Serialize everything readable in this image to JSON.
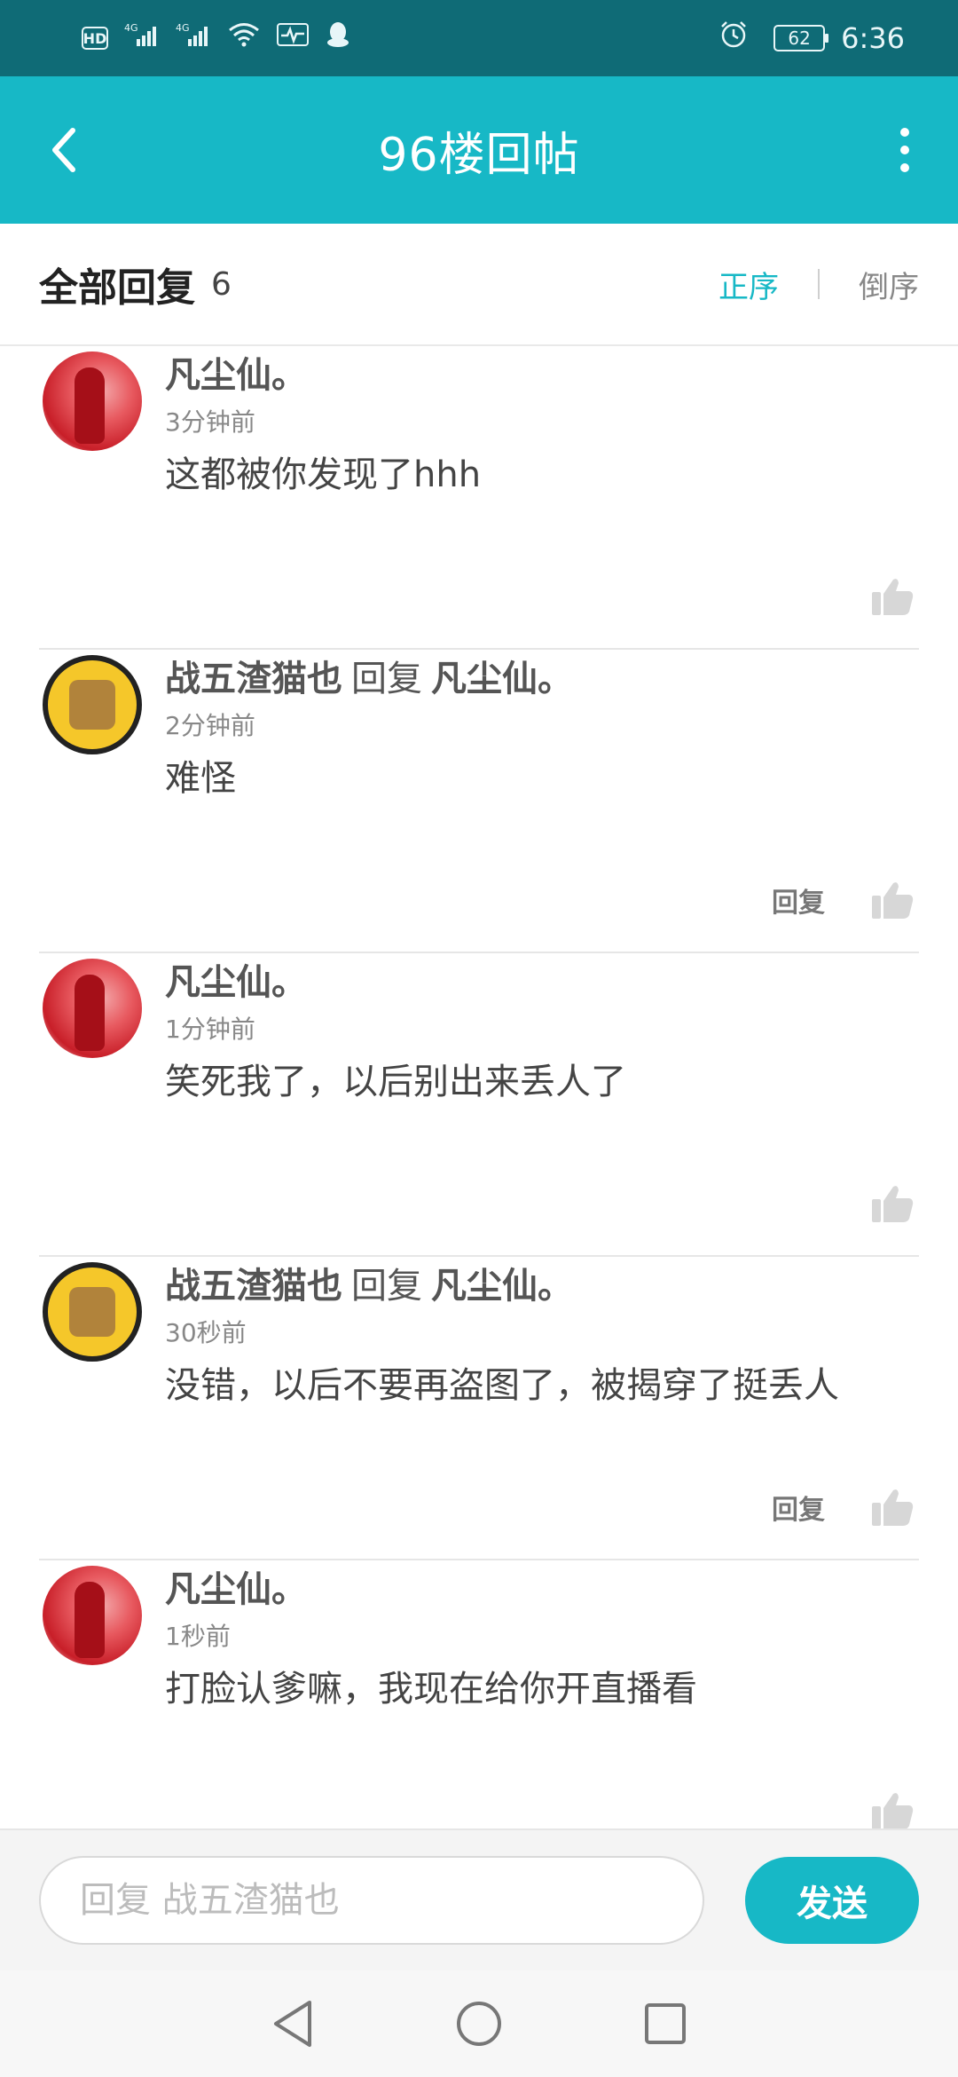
{
  "status_bar": {
    "left_icons": [
      "hd-icon",
      "signal-4g-icon",
      "signal-4g-icon",
      "wifi-icon",
      "pulse-icon",
      "qq-icon"
    ],
    "hd_label": "HD",
    "network_label": "4G",
    "alarm_icon": "alarm-icon",
    "battery_level": "62",
    "time": "6:36"
  },
  "header": {
    "title": "96楼回帖",
    "back_icon": "back-arrow-icon",
    "more_icon": "more-vertical-icon"
  },
  "replies_header": {
    "label": "全部回复",
    "count": "6",
    "sort_asc": "正序",
    "sort_desc": "倒序",
    "active_sort": "正序",
    "accent_color": "#17b8c6"
  },
  "replies": [
    {
      "author": "凡尘仙。",
      "reply_word": "",
      "reply_to": "",
      "time": "3分钟前",
      "content": "这都被你发现了hhh",
      "reply_button": "",
      "avatar": "red"
    },
    {
      "author": "战五渣猫也",
      "reply_word": "回复",
      "reply_to": "凡尘仙。",
      "time": "2分钟前",
      "content": "难怪",
      "reply_button": "回复",
      "avatar": "gold"
    },
    {
      "author": "凡尘仙。",
      "reply_word": "",
      "reply_to": "",
      "time": "1分钟前",
      "content": "笑死我了，以后别出来丢人了",
      "reply_button": "",
      "avatar": "red"
    },
    {
      "author": "战五渣猫也",
      "reply_word": "回复",
      "reply_to": "凡尘仙。",
      "time": "30秒前",
      "content": "没错，以后不要再盗图了，被揭穿了挺丢人",
      "reply_button": "回复",
      "avatar": "gold"
    },
    {
      "author": "凡尘仙。",
      "reply_word": "",
      "reply_to": "",
      "time": "1秒前",
      "content": "打脸认爹嘛，我现在给你开直播看",
      "reply_button": "",
      "avatar": "red"
    }
  ],
  "composer": {
    "placeholder": "回复 战五渣猫也",
    "send_label": "发送"
  },
  "nav_bar": {
    "icons": [
      "nav-back-icon",
      "nav-home-icon",
      "nav-recents-icon"
    ]
  }
}
